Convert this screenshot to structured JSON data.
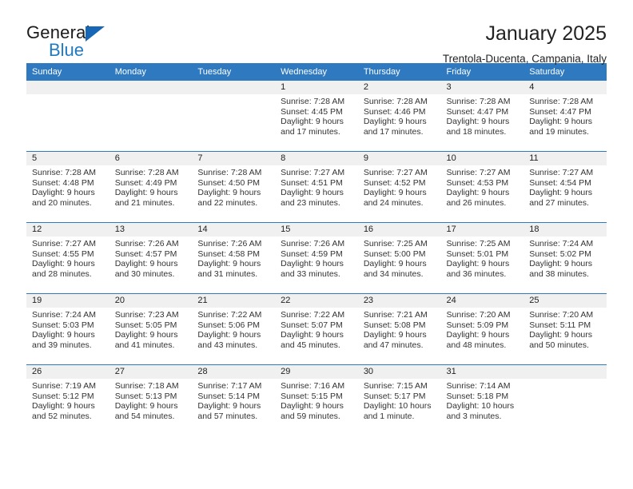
{
  "brand": {
    "name_top": "General",
    "name_bottom": "Blue",
    "accent_dark": "#1667b5",
    "accent_light": "#1f7ac4"
  },
  "header": {
    "title": "January 2025",
    "subtitle": "Trentola-Ducenta, Campania, Italy"
  },
  "theme": {
    "header_blue": "#2e79c0",
    "daynum_gray": "#f0f0f0",
    "text": "#222222"
  },
  "weekdays": [
    "Sunday",
    "Monday",
    "Tuesday",
    "Wednesday",
    "Thursday",
    "Friday",
    "Saturday"
  ],
  "weeks": [
    [
      {
        "day": "",
        "empty": true
      },
      {
        "day": "",
        "empty": true
      },
      {
        "day": "",
        "empty": true
      },
      {
        "day": "1",
        "sunrise": "Sunrise: 7:28 AM",
        "sunset": "Sunset: 4:45 PM",
        "daylight1": "Daylight: 9 hours",
        "daylight2": "and 17 minutes."
      },
      {
        "day": "2",
        "sunrise": "Sunrise: 7:28 AM",
        "sunset": "Sunset: 4:46 PM",
        "daylight1": "Daylight: 9 hours",
        "daylight2": "and 17 minutes."
      },
      {
        "day": "3",
        "sunrise": "Sunrise: 7:28 AM",
        "sunset": "Sunset: 4:47 PM",
        "daylight1": "Daylight: 9 hours",
        "daylight2": "and 18 minutes."
      },
      {
        "day": "4",
        "sunrise": "Sunrise: 7:28 AM",
        "sunset": "Sunset: 4:47 PM",
        "daylight1": "Daylight: 9 hours",
        "daylight2": "and 19 minutes."
      }
    ],
    [
      {
        "day": "5",
        "sunrise": "Sunrise: 7:28 AM",
        "sunset": "Sunset: 4:48 PM",
        "daylight1": "Daylight: 9 hours",
        "daylight2": "and 20 minutes."
      },
      {
        "day": "6",
        "sunrise": "Sunrise: 7:28 AM",
        "sunset": "Sunset: 4:49 PM",
        "daylight1": "Daylight: 9 hours",
        "daylight2": "and 21 minutes."
      },
      {
        "day": "7",
        "sunrise": "Sunrise: 7:28 AM",
        "sunset": "Sunset: 4:50 PM",
        "daylight1": "Daylight: 9 hours",
        "daylight2": "and 22 minutes."
      },
      {
        "day": "8",
        "sunrise": "Sunrise: 7:27 AM",
        "sunset": "Sunset: 4:51 PM",
        "daylight1": "Daylight: 9 hours",
        "daylight2": "and 23 minutes."
      },
      {
        "day": "9",
        "sunrise": "Sunrise: 7:27 AM",
        "sunset": "Sunset: 4:52 PM",
        "daylight1": "Daylight: 9 hours",
        "daylight2": "and 24 minutes."
      },
      {
        "day": "10",
        "sunrise": "Sunrise: 7:27 AM",
        "sunset": "Sunset: 4:53 PM",
        "daylight1": "Daylight: 9 hours",
        "daylight2": "and 26 minutes."
      },
      {
        "day": "11",
        "sunrise": "Sunrise: 7:27 AM",
        "sunset": "Sunset: 4:54 PM",
        "daylight1": "Daylight: 9 hours",
        "daylight2": "and 27 minutes."
      }
    ],
    [
      {
        "day": "12",
        "sunrise": "Sunrise: 7:27 AM",
        "sunset": "Sunset: 4:55 PM",
        "daylight1": "Daylight: 9 hours",
        "daylight2": "and 28 minutes."
      },
      {
        "day": "13",
        "sunrise": "Sunrise: 7:26 AM",
        "sunset": "Sunset: 4:57 PM",
        "daylight1": "Daylight: 9 hours",
        "daylight2": "and 30 minutes."
      },
      {
        "day": "14",
        "sunrise": "Sunrise: 7:26 AM",
        "sunset": "Sunset: 4:58 PM",
        "daylight1": "Daylight: 9 hours",
        "daylight2": "and 31 minutes."
      },
      {
        "day": "15",
        "sunrise": "Sunrise: 7:26 AM",
        "sunset": "Sunset: 4:59 PM",
        "daylight1": "Daylight: 9 hours",
        "daylight2": "and 33 minutes."
      },
      {
        "day": "16",
        "sunrise": "Sunrise: 7:25 AM",
        "sunset": "Sunset: 5:00 PM",
        "daylight1": "Daylight: 9 hours",
        "daylight2": "and 34 minutes."
      },
      {
        "day": "17",
        "sunrise": "Sunrise: 7:25 AM",
        "sunset": "Sunset: 5:01 PM",
        "daylight1": "Daylight: 9 hours",
        "daylight2": "and 36 minutes."
      },
      {
        "day": "18",
        "sunrise": "Sunrise: 7:24 AM",
        "sunset": "Sunset: 5:02 PM",
        "daylight1": "Daylight: 9 hours",
        "daylight2": "and 38 minutes."
      }
    ],
    [
      {
        "day": "19",
        "sunrise": "Sunrise: 7:24 AM",
        "sunset": "Sunset: 5:03 PM",
        "daylight1": "Daylight: 9 hours",
        "daylight2": "and 39 minutes."
      },
      {
        "day": "20",
        "sunrise": "Sunrise: 7:23 AM",
        "sunset": "Sunset: 5:05 PM",
        "daylight1": "Daylight: 9 hours",
        "daylight2": "and 41 minutes."
      },
      {
        "day": "21",
        "sunrise": "Sunrise: 7:22 AM",
        "sunset": "Sunset: 5:06 PM",
        "daylight1": "Daylight: 9 hours",
        "daylight2": "and 43 minutes."
      },
      {
        "day": "22",
        "sunrise": "Sunrise: 7:22 AM",
        "sunset": "Sunset: 5:07 PM",
        "daylight1": "Daylight: 9 hours",
        "daylight2": "and 45 minutes."
      },
      {
        "day": "23",
        "sunrise": "Sunrise: 7:21 AM",
        "sunset": "Sunset: 5:08 PM",
        "daylight1": "Daylight: 9 hours",
        "daylight2": "and 47 minutes."
      },
      {
        "day": "24",
        "sunrise": "Sunrise: 7:20 AM",
        "sunset": "Sunset: 5:09 PM",
        "daylight1": "Daylight: 9 hours",
        "daylight2": "and 48 minutes."
      },
      {
        "day": "25",
        "sunrise": "Sunrise: 7:20 AM",
        "sunset": "Sunset: 5:11 PM",
        "daylight1": "Daylight: 9 hours",
        "daylight2": "and 50 minutes."
      }
    ],
    [
      {
        "day": "26",
        "sunrise": "Sunrise: 7:19 AM",
        "sunset": "Sunset: 5:12 PM",
        "daylight1": "Daylight: 9 hours",
        "daylight2": "and 52 minutes."
      },
      {
        "day": "27",
        "sunrise": "Sunrise: 7:18 AM",
        "sunset": "Sunset: 5:13 PM",
        "daylight1": "Daylight: 9 hours",
        "daylight2": "and 54 minutes."
      },
      {
        "day": "28",
        "sunrise": "Sunrise: 7:17 AM",
        "sunset": "Sunset: 5:14 PM",
        "daylight1": "Daylight: 9 hours",
        "daylight2": "and 57 minutes."
      },
      {
        "day": "29",
        "sunrise": "Sunrise: 7:16 AM",
        "sunset": "Sunset: 5:15 PM",
        "daylight1": "Daylight: 9 hours",
        "daylight2": "and 59 minutes."
      },
      {
        "day": "30",
        "sunrise": "Sunrise: 7:15 AM",
        "sunset": "Sunset: 5:17 PM",
        "daylight1": "Daylight: 10 hours",
        "daylight2": "and 1 minute."
      },
      {
        "day": "31",
        "sunrise": "Sunrise: 7:14 AM",
        "sunset": "Sunset: 5:18 PM",
        "daylight1": "Daylight: 10 hours",
        "daylight2": "and 3 minutes."
      },
      {
        "day": "",
        "empty": true
      }
    ]
  ]
}
